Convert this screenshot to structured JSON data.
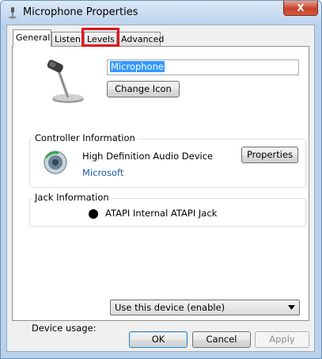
{
  "window": {
    "title": "Microphone Properties",
    "close_label": "X"
  },
  "tabs": [
    {
      "label": "General",
      "active": true
    },
    {
      "label": "Listen"
    },
    {
      "label": "Levels"
    },
    {
      "label": "Advanced"
    }
  ],
  "general": {
    "device_name": "Microphone",
    "change_icon_label": "Change Icon"
  },
  "controller": {
    "group_label": "Controller Information",
    "device_name": "High Definition Audio Device",
    "vendor": "Microsoft",
    "properties_label": "Properties"
  },
  "jack": {
    "group_label": "Jack Information",
    "jack_name": "ATAPI Internal ATAPI Jack",
    "jack_color": "#000000"
  },
  "device_usage": {
    "label": "Device usage:",
    "value": "Use this device (enable)"
  },
  "footer": {
    "ok_label": "OK",
    "cancel_label": "Cancel",
    "apply_label": "Apply"
  },
  "colors": {
    "highlight_box": "#e0141e",
    "link_blue": "#1e5aa8",
    "selection": "#3399ff"
  }
}
